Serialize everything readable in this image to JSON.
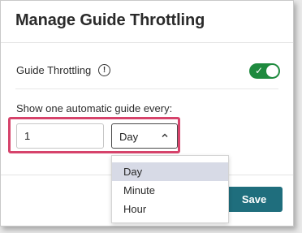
{
  "modal": {
    "title": "Manage Guide Throttling"
  },
  "throttling": {
    "label": "Guide Throttling",
    "info_glyph": "!",
    "toggle_on": true,
    "toggle_check": "✓"
  },
  "frequency": {
    "label": "Show one automatic guide every:",
    "amount": "1",
    "unit": "Day",
    "options": [
      "Day",
      "Minute",
      "Hour"
    ],
    "selected_index": 0
  },
  "footer": {
    "save_label": "Save"
  },
  "colors": {
    "toggle": "#1e8a3e",
    "save_button": "#1f6e7d",
    "highlight": "#d6436b",
    "selected_option": "#d7dae6"
  }
}
